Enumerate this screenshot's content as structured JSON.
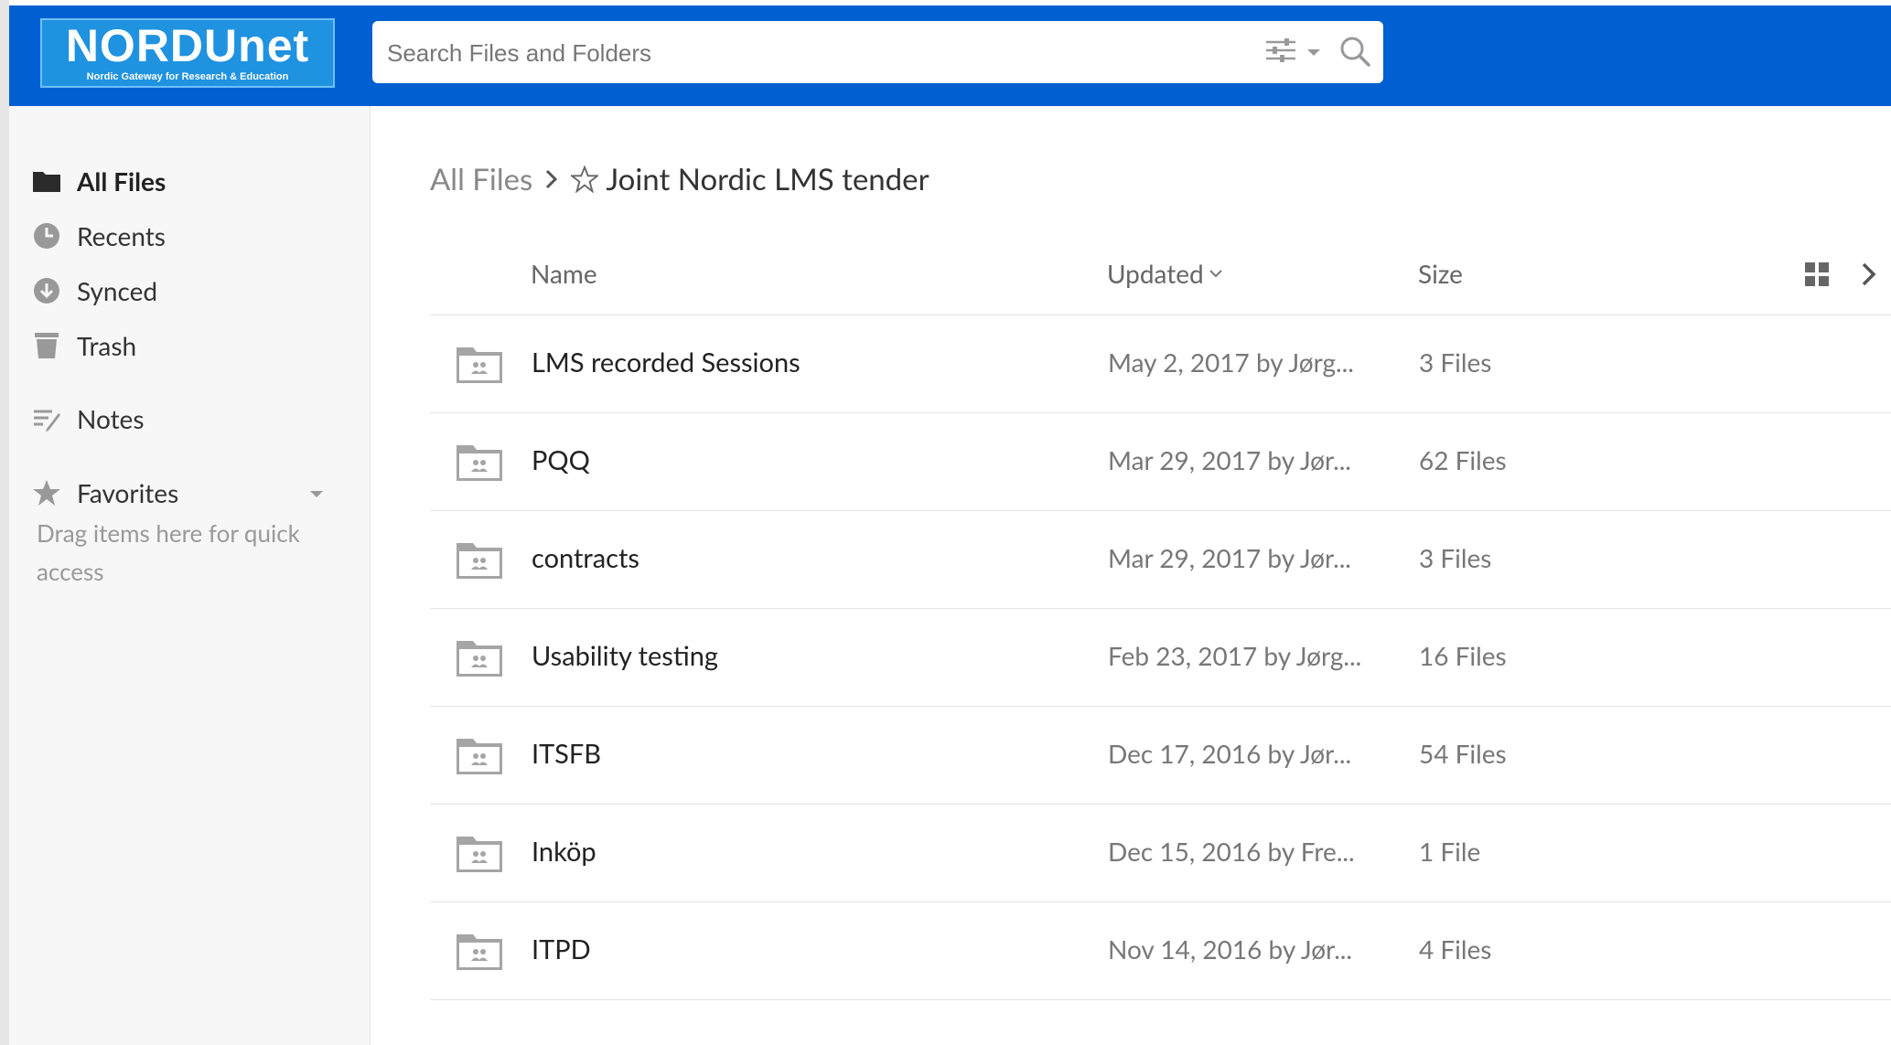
{
  "header": {
    "logo_main": "NORDUnet",
    "logo_sub": "Nordic Gateway for Research & Education",
    "search_placeholder": "Search Files and Folders",
    "brand_color": "#0060d1"
  },
  "sidebar": {
    "items": [
      {
        "label": "All Files",
        "icon": "folder-icon",
        "active": true
      },
      {
        "label": "Recents",
        "icon": "clock-icon"
      },
      {
        "label": "Synced",
        "icon": "download-icon"
      },
      {
        "label": "Trash",
        "icon": "trash-icon"
      },
      {
        "label": "Notes",
        "icon": "notes-icon"
      },
      {
        "label": "Favorites",
        "icon": "star-icon"
      }
    ],
    "favorites_hint": "Drag items here for quick access"
  },
  "breadcrumb": {
    "root": "All Files",
    "current": "Joint Nordic LMS tender"
  },
  "table": {
    "columns": {
      "name": "Name",
      "updated": "Updated",
      "size": "Size"
    },
    "rows": [
      {
        "name": "LMS recorded Sessions",
        "updated": "May 2, 2017 by Jørg...",
        "size": "3 Files"
      },
      {
        "name": "PQQ",
        "updated": "Mar 29, 2017 by Jør...",
        "size": "62 Files"
      },
      {
        "name": "contracts",
        "updated": "Mar 29, 2017 by Jør...",
        "size": "3 Files"
      },
      {
        "name": "Usability testing",
        "updated": "Feb 23, 2017 by Jørg...",
        "size": "16 Files"
      },
      {
        "name": "ITSFB",
        "updated": "Dec 17, 2016 by Jør...",
        "size": "54 Files"
      },
      {
        "name": "Inköp",
        "updated": "Dec 15, 2016 by Fre...",
        "size": "1 File"
      },
      {
        "name": "ITPD",
        "updated": "Nov 14, 2016 by Jør...",
        "size": "4 Files"
      }
    ]
  }
}
